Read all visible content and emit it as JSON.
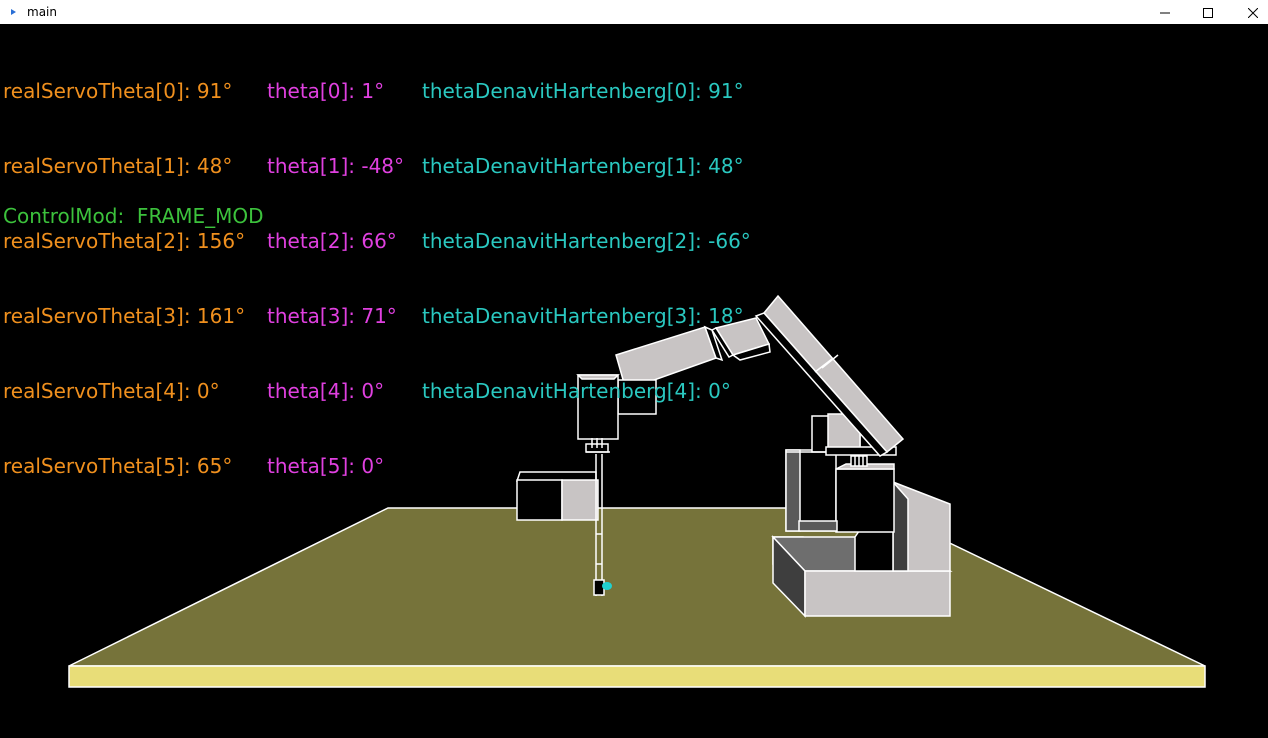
{
  "window": {
    "title": "main",
    "controls": [
      "minimize-icon",
      "maximize-icon",
      "close-icon"
    ]
  },
  "hud": {
    "real_servo_theta": [
      "realServoTheta[0]: 91°",
      "realServoTheta[1]: 48°",
      "realServoTheta[2]: 156°",
      "realServoTheta[3]: 161°",
      "realServoTheta[4]: 0°",
      "realServoTheta[5]: 65°"
    ],
    "theta": [
      "theta[0]: 1°",
      "theta[1]: -48°",
      "theta[2]: 66°",
      "theta[3]: 71°",
      "theta[4]: 0°",
      "theta[5]: 0°"
    ],
    "theta_dh": [
      "thetaDenavitHartenberg[0]: 91°",
      "thetaDenavitHartenberg[1]: 48°",
      "thetaDenavitHartenberg[2]: -66°",
      "thetaDenavitHartenberg[3]: 18°",
      "thetaDenavitHartenberg[4]: 0°"
    ],
    "control_mode": "ControlMod:  FRAME_MOD"
  },
  "colors": {
    "real_servo": "#f0901e",
    "theta": "#e040e0",
    "theta_dh": "#2ac8c0",
    "control_mode": "#3cc23c",
    "floor": "#76733a",
    "floor_edge": "#e8dd78",
    "robot_face": "#c8c4c4",
    "robot_edge": "#ffffff",
    "gripper_tip": "#20d0d0"
  }
}
